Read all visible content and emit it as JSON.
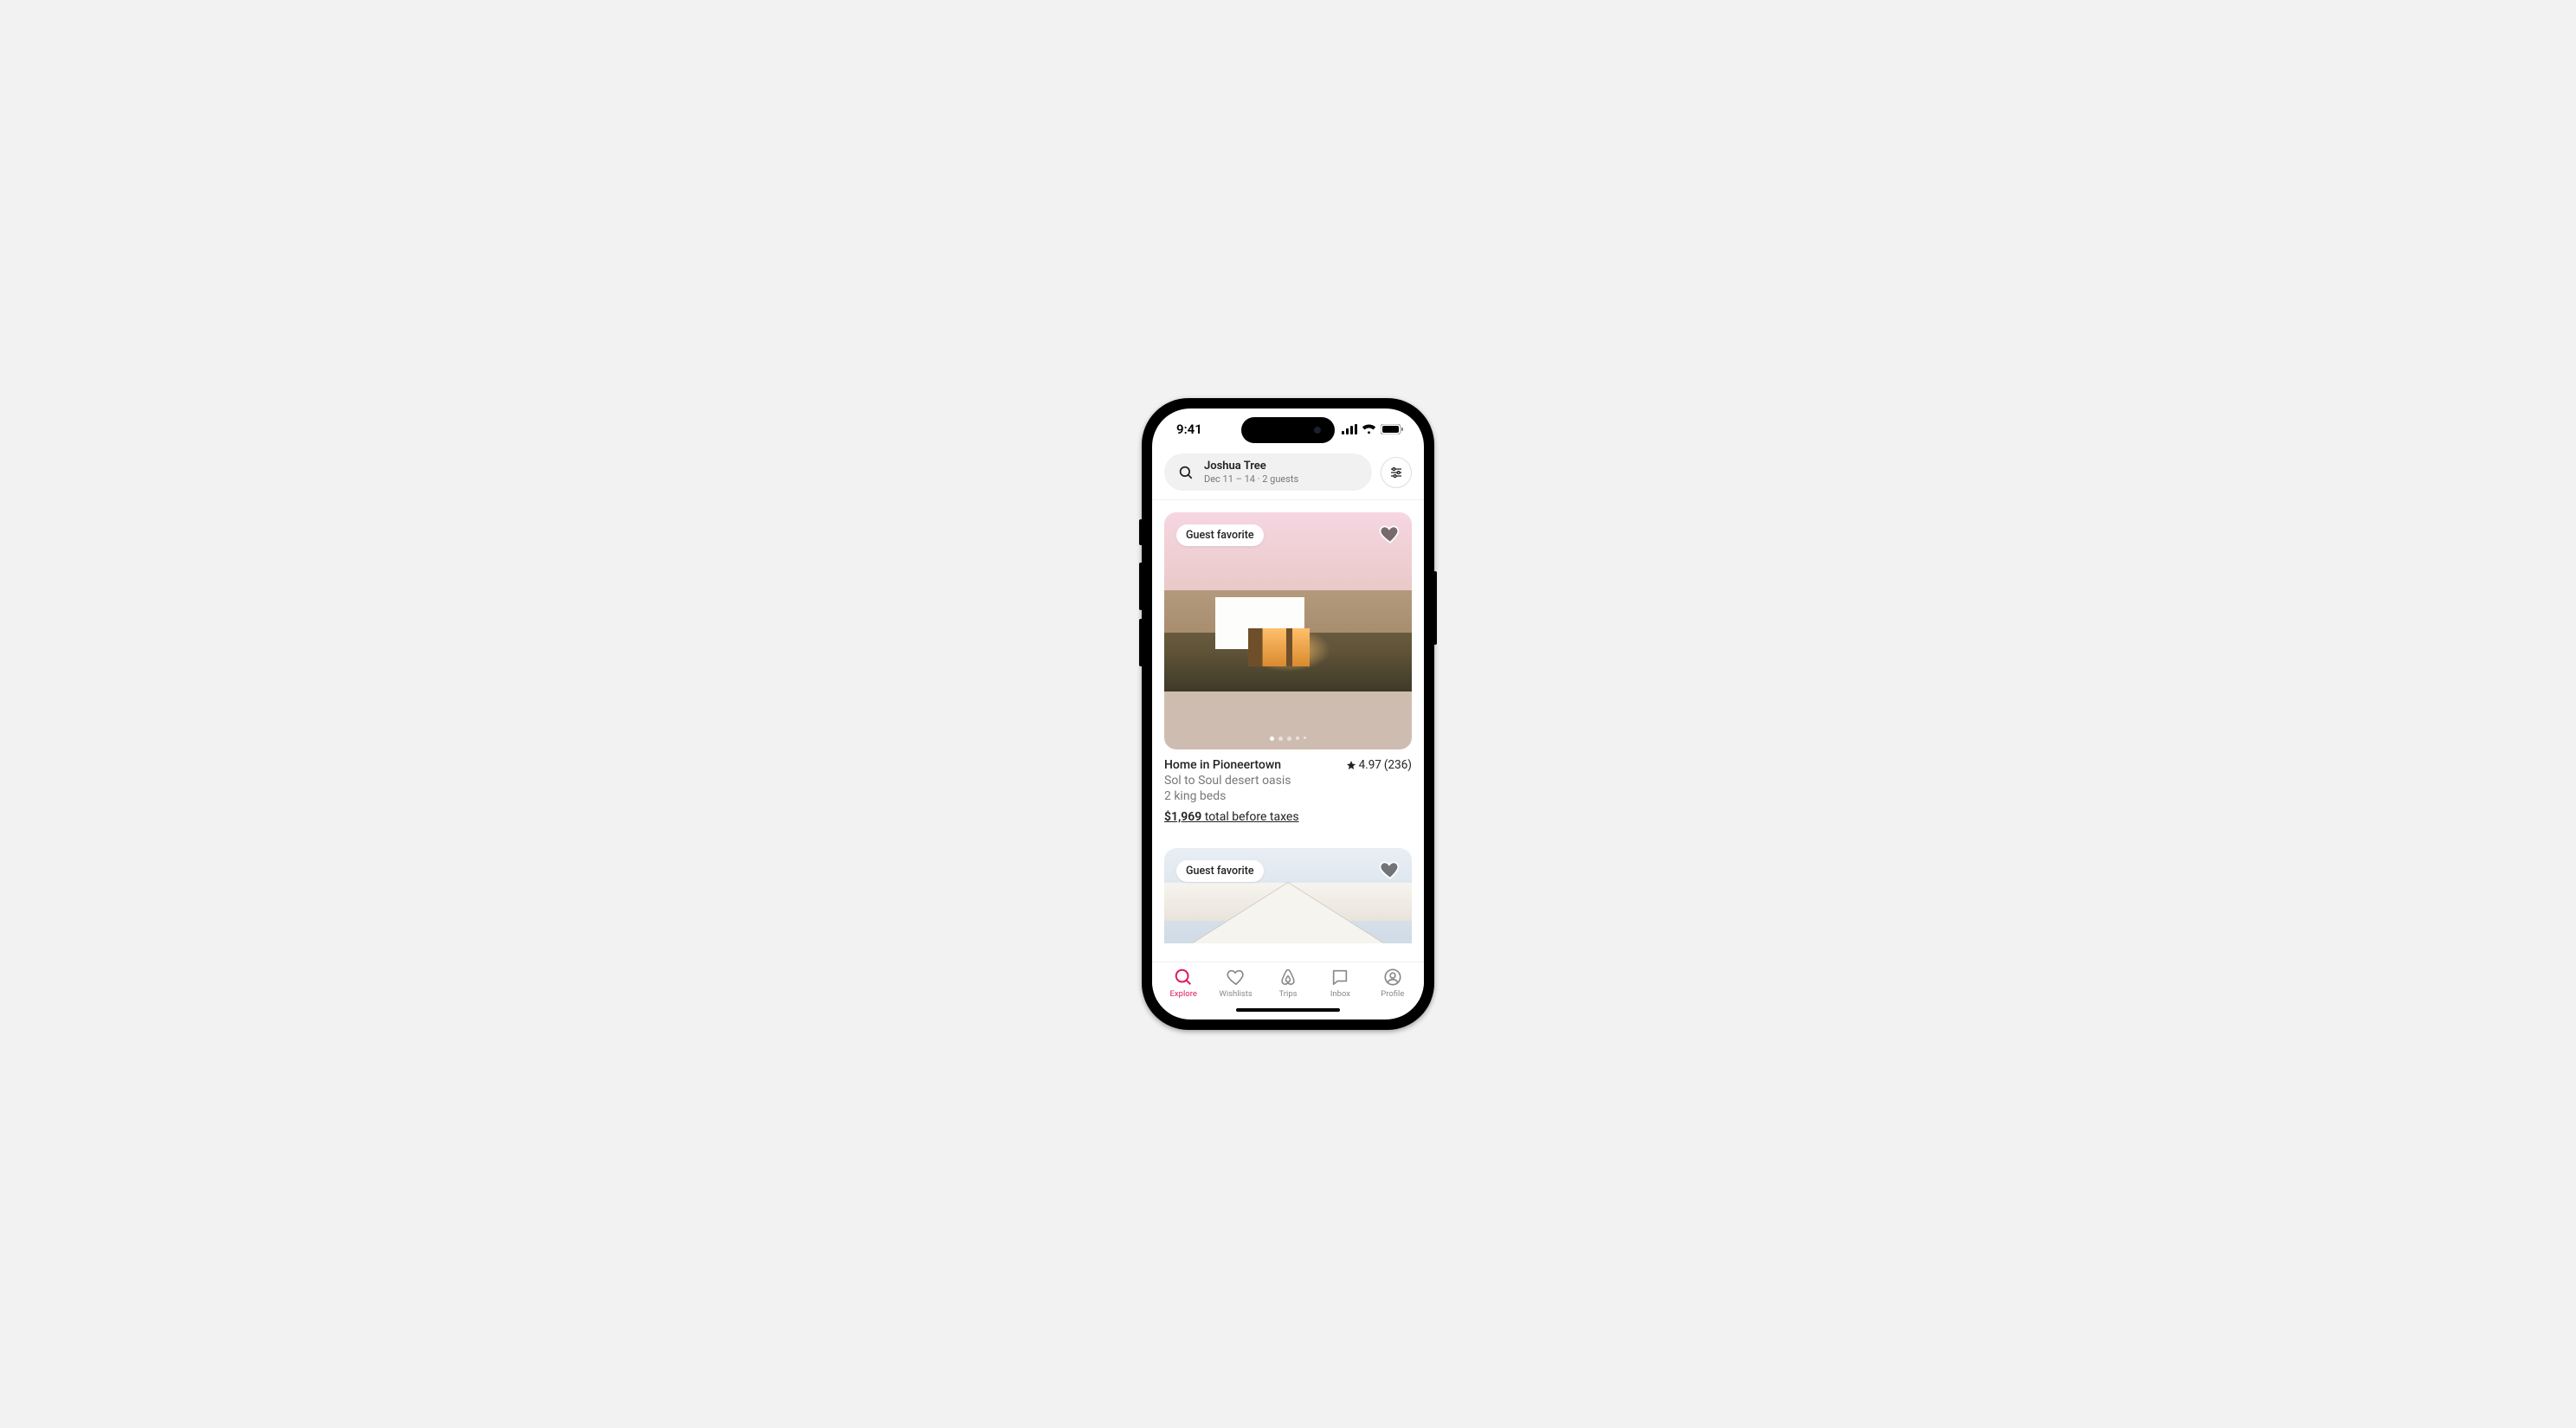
{
  "status": {
    "time": "9:41"
  },
  "search": {
    "location": "Joshua Tree",
    "details": "Dec 11 – 14 · 2 guests"
  },
  "listings": [
    {
      "badge": "Guest favorite",
      "title": "Home in Pioneertown",
      "rating": "4.97",
      "reviews": "(236)",
      "tagline": "Sol to Soul desert oasis",
      "beds": "2 king beds",
      "price": "$1,969",
      "price_suffix": " total before taxes"
    },
    {
      "badge": "Guest favorite"
    }
  ],
  "tabs": {
    "explore": "Explore",
    "wishlists": "Wishlists",
    "trips": "Trips",
    "inbox": "Inbox",
    "profile": "Profile"
  }
}
